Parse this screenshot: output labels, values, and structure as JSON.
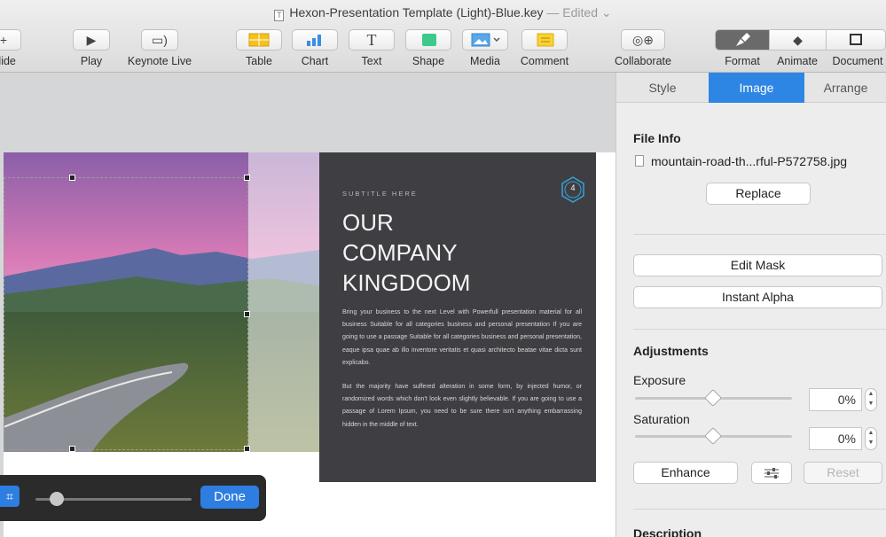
{
  "window": {
    "title": "Hexon-Presentation Template (Light)-Blue.key",
    "status": "— Edited ⌄"
  },
  "toolbar": {
    "slide": "Slide",
    "play": "Play",
    "keynote_live": "Keynote Live",
    "table": "Table",
    "chart": "Chart",
    "text": "Text",
    "shape": "Shape",
    "media": "Media",
    "comment": "Comment",
    "collaborate": "Collaborate",
    "format": "Format",
    "animate": "Animate",
    "document": "Document",
    "accent_color": "#2e86e4"
  },
  "slide": {
    "subtitle": "SUBTITLE HERE",
    "title": "OUR\nCOMPANY\nKINGDOOM",
    "badge": "4",
    "paragraph1": "Bring your business to the next Level with Powerfull presentation material for all business Suitable for all categories business and personal presentation If you are going to use a passage Suitable for all categories business and personal presentation, eaque ipsa quae ab illo inventore veritatis et quasi architecto beatae vitae dicta sunt explicabo.",
    "paragraph2": "But the majority have suffered alteration in some form, by injected humor, or randomized words which don't look even slightly believable. If you are going to use a passage of Lorem Ipsum, you need to be sure there isn't anything embarrassing hidden in the middle of text."
  },
  "mask_bar": {
    "done": "Done",
    "scale": 0.15
  },
  "inspector": {
    "tabs": [
      "Style",
      "Image",
      "Arrange"
    ],
    "active_tab": "Image",
    "file_info_heading": "File Info",
    "file_name": "mountain-road-th...rful-P572758.jpg",
    "replace": "Replace",
    "edit_mask": "Edit Mask",
    "instant_alpha": "Instant Alpha",
    "adjustments_heading": "Adjustments",
    "exposure_label": "Exposure",
    "exposure_value": "0%",
    "saturation_label": "Saturation",
    "saturation_value": "0%",
    "enhance": "Enhance",
    "reset": "Reset",
    "description_heading": "Description"
  }
}
